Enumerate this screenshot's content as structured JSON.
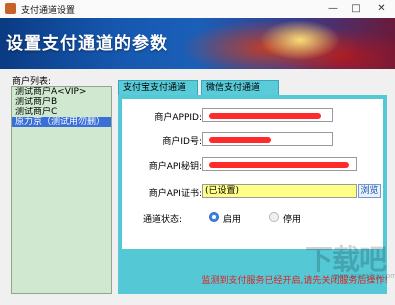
{
  "window": {
    "title": "支付通道设置",
    "minimize_glyph": "—",
    "maximize_glyph": "□",
    "close_glyph": "✕"
  },
  "banner": {
    "title": "设置支付通道的参数"
  },
  "merchants": {
    "label": "商户列表:",
    "items": [
      "测试商户A<VIP>",
      "测试商户B",
      "测试商户C",
      "原力京（测试用勿删）"
    ],
    "selected_index": 3
  },
  "tabs": [
    {
      "label": "支付宝支付通道",
      "active": true
    },
    {
      "label": "微信支付通道",
      "active": false
    }
  ],
  "form": {
    "appid_label": "商户APPID:",
    "merchant_id_label": "商户ID号:",
    "api_secret_label": "商户API秘钥:",
    "api_cert_label": "商户API证书:",
    "api_cert_value": "(已设置)",
    "browse_label": "浏览",
    "status_label": "通道状态:",
    "status_enabled": "启用",
    "status_disabled": "停用",
    "status_selected": "启用"
  },
  "status_message": "监测到支付服务已经开启,请先关闭服务后操作!",
  "watermark": {
    "text": "下载吧",
    "sub": "www.xiazaiba.com"
  },
  "colors": {
    "panel_accent": "#55c8d6",
    "list_bg": "#cfe8cf",
    "selection": "#3a6fd8",
    "cert_field": "#ffff88",
    "warning_text": "#e02020",
    "redaction": "#ff2b2b"
  },
  "icons": {
    "app": "app-icon",
    "minimize": "minimize-icon",
    "maximize": "maximize-icon",
    "close": "close-icon"
  }
}
